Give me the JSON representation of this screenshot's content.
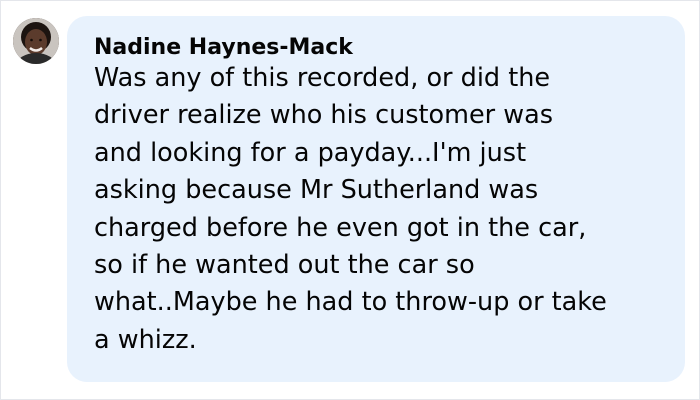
{
  "comment": {
    "author": "Nadine Haynes-Mack",
    "avatar_icon": "profile-photo",
    "lines": [
      "Was any of this recorded, or did the",
      "driver realize who his customer was",
      "and looking for a payday...I'm just",
      "asking because Mr Sutherland was",
      "charged before he even got in the car,",
      "so if he wanted out the car so",
      "what..Maybe he had to throw-up or take",
      "a whizz."
    ]
  },
  "colors": {
    "bubble_background": "#e8f2fd",
    "text": "#050505",
    "frame_border": "#e4e6eb"
  }
}
